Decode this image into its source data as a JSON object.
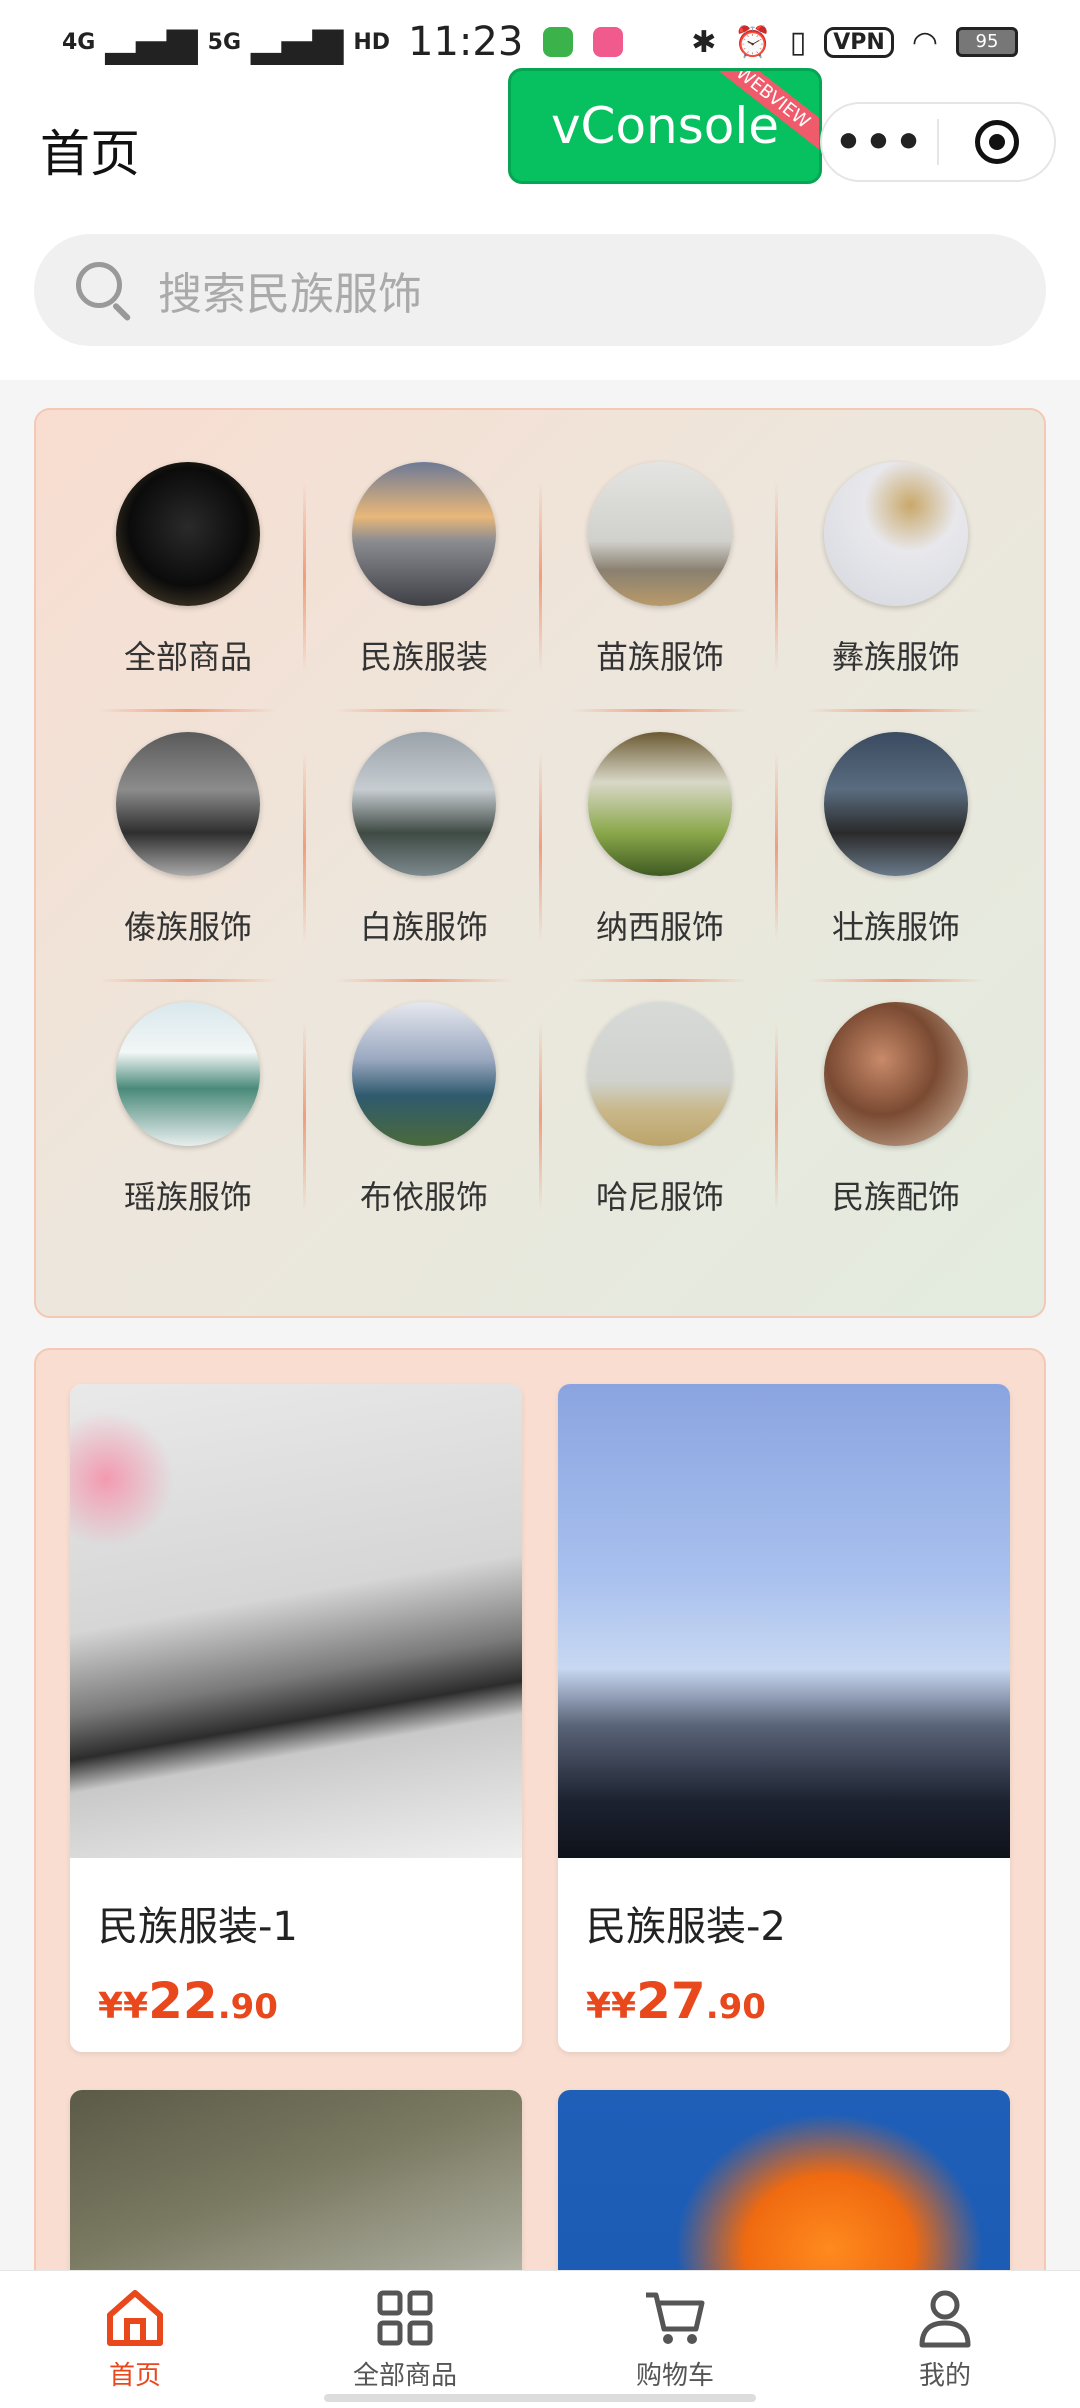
{
  "status_bar": {
    "signal_1": "4G",
    "signal_2": "5G",
    "hd": "HD",
    "time": "11:23",
    "vpn": "VPN",
    "battery": "95"
  },
  "nav": {
    "title": "首页",
    "vconsole_label": "vConsole",
    "vconsole_ribbon": "WEBVIEW"
  },
  "search": {
    "placeholder": "搜索民族服饰"
  },
  "categories": [
    {
      "label": "全部商品"
    },
    {
      "label": "民族服装"
    },
    {
      "label": "苗族服饰"
    },
    {
      "label": "彝族服饰"
    },
    {
      "label": "傣族服饰"
    },
    {
      "label": "白族服饰"
    },
    {
      "label": "纳西服饰"
    },
    {
      "label": "壮族服饰"
    },
    {
      "label": "瑶族服饰"
    },
    {
      "label": "布依服饰"
    },
    {
      "label": "哈尼服饰"
    },
    {
      "label": "民族配饰"
    }
  ],
  "products": [
    {
      "name": "民族服装-1",
      "price_symbol": "¥¥",
      "price_int": "22",
      "price_dec": ".90"
    },
    {
      "name": "民族服装-2",
      "price_symbol": "¥¥",
      "price_int": "27",
      "price_dec": ".90"
    }
  ],
  "tabs": [
    {
      "label": "首页",
      "icon": "home-icon",
      "active": true
    },
    {
      "label": "全部商品",
      "icon": "grid-icon",
      "active": false
    },
    {
      "label": "购物车",
      "icon": "cart-icon",
      "active": false
    },
    {
      "label": "我的",
      "icon": "user-icon",
      "active": false
    }
  ],
  "colors": {
    "accent": "#e8481c",
    "vconsole_green": "#07c160"
  }
}
